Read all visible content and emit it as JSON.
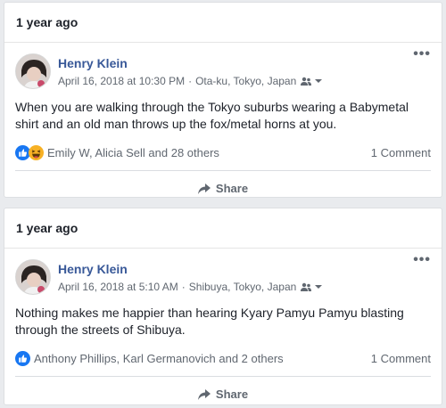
{
  "posts": [
    {
      "header": "1 year ago",
      "author": "Henry Klein",
      "date": "April 16, 2018 at 10:30 PM",
      "separator": "·",
      "location": "Ota-ku, Tokyo, Japan",
      "more": "•••",
      "text": "When you are walking through the Tokyo suburbs wearing a Babymetal shirt and an old man throws up the fox/metal horns at you.",
      "reactions_text": "Emily W, Alicia Sell and 28 others",
      "reaction_icons": [
        "like-icon",
        "haha-icon"
      ],
      "comments": "1 Comment",
      "share_label": "Share"
    },
    {
      "header": "1 year ago",
      "author": "Henry Klein",
      "date": "April 16, 2018 at 5:10 AM",
      "separator": "·",
      "location": "Shibuya, Tokyo, Japan",
      "more": "•••",
      "text": "Nothing makes me happier than hearing Kyary Pamyu Pamyu blasting through the streets of Shibuya.",
      "reactions_text": "Anthony Phillips, Karl Germanovich and 2 others",
      "reaction_icons": [
        "like-icon"
      ],
      "comments": "1 Comment",
      "share_label": "Share"
    }
  ],
  "colors": {
    "link": "#385898",
    "meta": "#606770",
    "like_blue": "#1877f2",
    "haha_yellow": "#f7b125"
  }
}
